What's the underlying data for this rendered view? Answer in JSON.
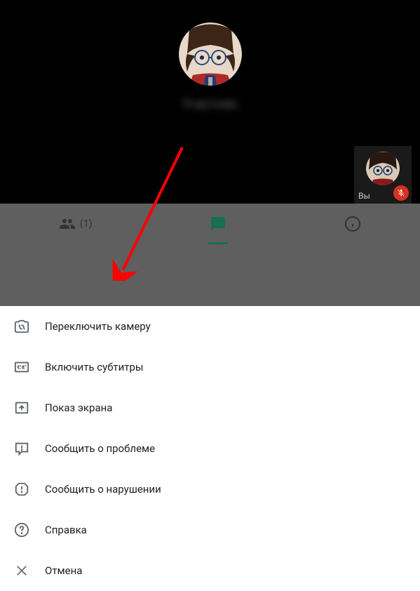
{
  "video": {
    "participant_name_blurred": "Участник",
    "self_label": "Вы"
  },
  "tabs": {
    "people_count": "(1)"
  },
  "menu": {
    "switch_camera": "Переключить камеру",
    "enable_captions": "Включить субтитры",
    "present_screen": "Показ экрана",
    "report_problem": "Сообщить о проблеме",
    "report_abuse": "Сообщить о нарушении",
    "help": "Справка",
    "cancel": "Отмена"
  },
  "colors": {
    "accent": "#1a6e52",
    "danger": "#d93025",
    "overlay": "#5f5f5f"
  }
}
